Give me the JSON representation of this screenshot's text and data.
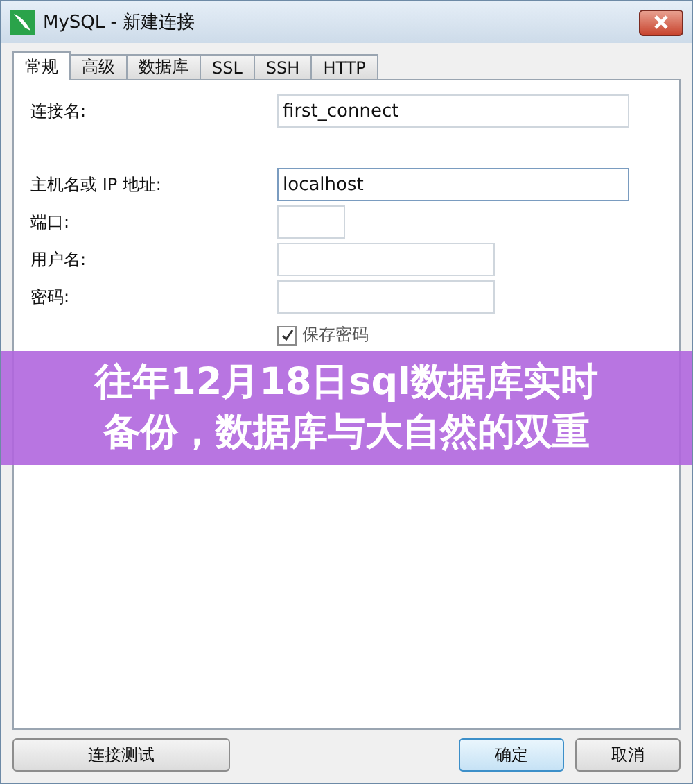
{
  "window": {
    "title": "MySQL - 新建连接"
  },
  "tabs": [
    {
      "label": "常规",
      "selected": true
    },
    {
      "label": "高级",
      "selected": false
    },
    {
      "label": "数据库",
      "selected": false
    },
    {
      "label": "SSL",
      "selected": false
    },
    {
      "label": "SSH",
      "selected": false
    },
    {
      "label": "HTTP",
      "selected": false
    }
  ],
  "fields": [
    {
      "label": "连接名:",
      "value": "first_connect",
      "focused": false
    },
    {
      "label": "主机名或 IP 地址:",
      "value": "localhost",
      "focused": true
    },
    {
      "label": "端口:",
      "focused": false
    },
    {
      "label": "用户名:",
      "focused": false
    },
    {
      "label": "密码:",
      "focused": false
    }
  ],
  "save_password": {
    "label": "保存密码",
    "checked": true
  },
  "banner": {
    "lines": [
      "往年12月18日sql数据库实时",
      "备份，数据库与大自然的双重"
    ]
  },
  "buttons": [
    {
      "label": "连接测试",
      "kind": "left"
    },
    {
      "label": "确定",
      "kind": "default"
    },
    {
      "label": "取消",
      "kind": "normal"
    }
  ]
}
